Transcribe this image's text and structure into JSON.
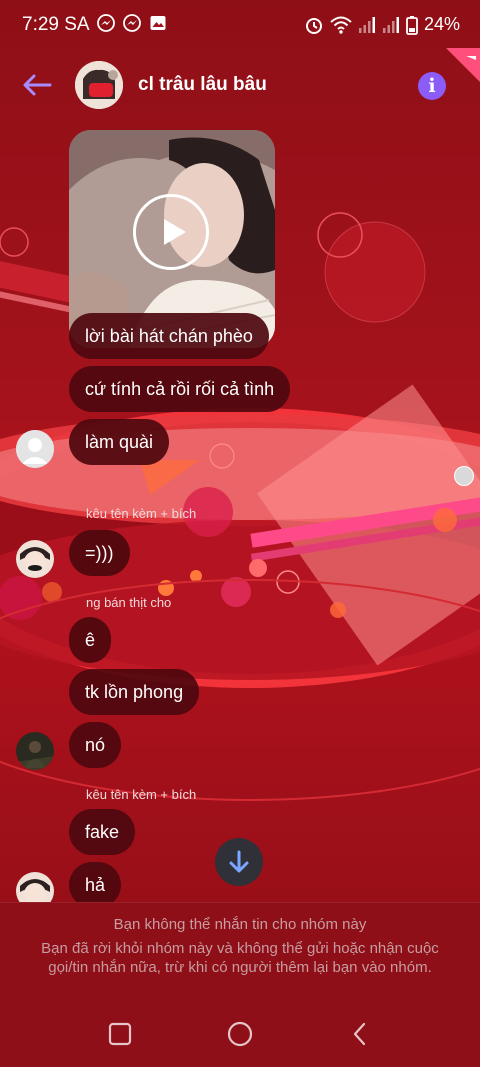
{
  "status_bar": {
    "time": "7:29 SA",
    "battery": "24%"
  },
  "header": {
    "title": "cl trâu lâu bâu"
  },
  "messages": [
    {
      "text": "lời bài hát chán phèo"
    },
    {
      "text": "cứ tính cả rồi rối cả tình"
    },
    {
      "text": "làm quài"
    },
    {
      "text": "=)))"
    },
    {
      "text": "ê"
    },
    {
      "text": "tk lồn phong"
    },
    {
      "text": "nó"
    },
    {
      "text": "fake"
    },
    {
      "text": "hả"
    }
  ],
  "senders": [
    "kêu tên kèm + bích",
    "ng bán thịt cho",
    "kêu tên kèm + bích"
  ],
  "footer": {
    "title": "Bạn không thể nhắn tin cho nhóm này",
    "body": "Bạn đã rời khỏi nhóm này và không thể gửi hoặc nhận cuộc gọi/tin nhắn nữa, trừ khi có người thêm lại bạn vào nhóm."
  },
  "colors": {
    "background": "#a3121b",
    "bubble": "#4e080e",
    "accent": "#8b5cf6"
  },
  "icons": [
    "back-arrow-icon",
    "info-icon",
    "play-icon",
    "scroll-down-arrow-icon",
    "recent-apps-icon",
    "home-icon",
    "back-icon"
  ]
}
